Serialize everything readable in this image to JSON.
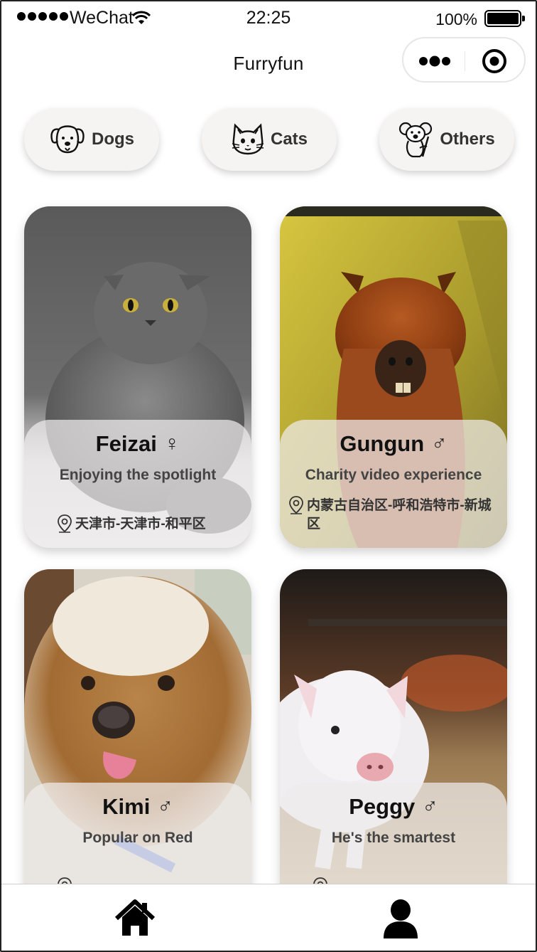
{
  "status_bar": {
    "carrier": "WeChat",
    "time": "22:25",
    "battery": "100%"
  },
  "nav": {
    "title": "Furryfun",
    "more_icon": "more-dots-icon",
    "close_icon": "target-close-icon"
  },
  "categories": [
    {
      "label": "Dogs",
      "icon": "dog-icon"
    },
    {
      "label": "Cats",
      "icon": "cat-icon"
    },
    {
      "label": "Others",
      "icon": "koala-icon"
    }
  ],
  "pets": [
    {
      "name": "Feizai",
      "gender": "♀",
      "desc": "Enjoying the spotlight",
      "location": "天津市-天津市-和平区",
      "photo": "gray scottish fold cat"
    },
    {
      "name": "Gungun",
      "gender": "♂",
      "desc": "Charity video experience",
      "location": "内蒙古自治区-呼和浩特市-新城区",
      "photo": "brown alpaca"
    },
    {
      "name": "Kimi",
      "gender": "♂",
      "desc": "Popular on Red",
      "location": "",
      "photo": "brown poodle"
    },
    {
      "name": "Peggy",
      "gender": "♂",
      "desc": "He's the smartest",
      "location": "",
      "photo": "white piglet"
    }
  ],
  "tab_bar": {
    "home_icon": "home-icon",
    "profile_icon": "user-icon"
  }
}
